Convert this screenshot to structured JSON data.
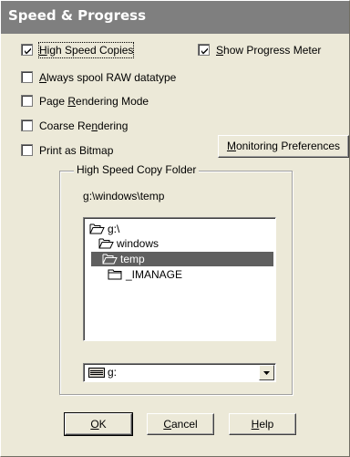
{
  "dialog": {
    "title": "Speed & Progress"
  },
  "options": {
    "high_speed": {
      "pre": "",
      "ul": "H",
      "post": "igh Speed Copies",
      "checked": true
    },
    "show_progress": {
      "pre": "",
      "ul": "S",
      "post": "how Progress Meter",
      "checked": true
    },
    "spool_raw": {
      "pre": "",
      "ul": "A",
      "post": "lways spool RAW datatype",
      "checked": false
    },
    "page_render": {
      "pre": "Page ",
      "ul": "R",
      "post": "endering Mode",
      "checked": false
    },
    "coarse_render": {
      "pre": "Coarse Re",
      "ul": "n",
      "post": "dering",
      "checked": false
    },
    "print_bitmap": {
      "pre": "Print as Bitmap",
      "ul": "",
      "post": "",
      "checked": false
    }
  },
  "monitoring_button": {
    "pre": "",
    "ul": "M",
    "post": "onitoring Preferences"
  },
  "folder_group": {
    "title": "High Speed Copy Folder",
    "path": {
      "ul": "g",
      "post": ":\\windows\\temp"
    },
    "tree": [
      {
        "label": "g:\\",
        "icon": "open-folder-icon",
        "selected": false
      },
      {
        "label": "windows",
        "icon": "open-folder-icon",
        "selected": false
      },
      {
        "label": "temp",
        "icon": "open-folder-icon",
        "selected": true
      },
      {
        "label": "_IMANAGE",
        "icon": "folder-icon",
        "selected": false
      }
    ],
    "drive": {
      "label": "g:",
      "icon": "drive-icon"
    }
  },
  "buttons": {
    "ok": {
      "ul": "O",
      "post": "K"
    },
    "cancel": {
      "ul": "C",
      "post": "ancel"
    },
    "help": {
      "ul": "H",
      "post": "elp"
    }
  }
}
